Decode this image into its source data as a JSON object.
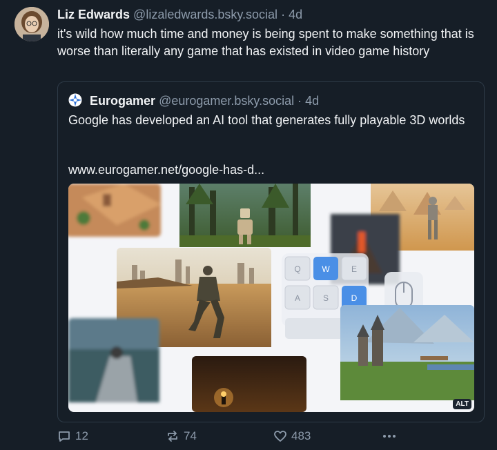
{
  "post": {
    "author_name": "Liz Edwards",
    "author_handle": "@lizaledwards.bsky.social",
    "separator": "·",
    "time": "4d",
    "text": "it's wild how much time and money is being spent to make something that is worse than literally any game that has existed in video game history"
  },
  "quote": {
    "author_name": "Eurogamer",
    "author_handle": "@eurogamer.bsky.social",
    "separator": "·",
    "time": "4d",
    "text": "Google has developed an AI tool that generates fully playable 3D worlds",
    "link": "www.eurogamer.net/google-has-d...",
    "alt_badge": "ALT",
    "keys": [
      "Q",
      "W",
      "E",
      "A",
      "S",
      "D"
    ]
  },
  "actions": {
    "replies": "12",
    "reposts": "74",
    "likes": "483"
  },
  "colors": {
    "background": "#161e27",
    "text": "#f1f3f5",
    "muted": "#8d9bab",
    "border": "#2e3b48",
    "key_active": "#4a8fe6"
  }
}
